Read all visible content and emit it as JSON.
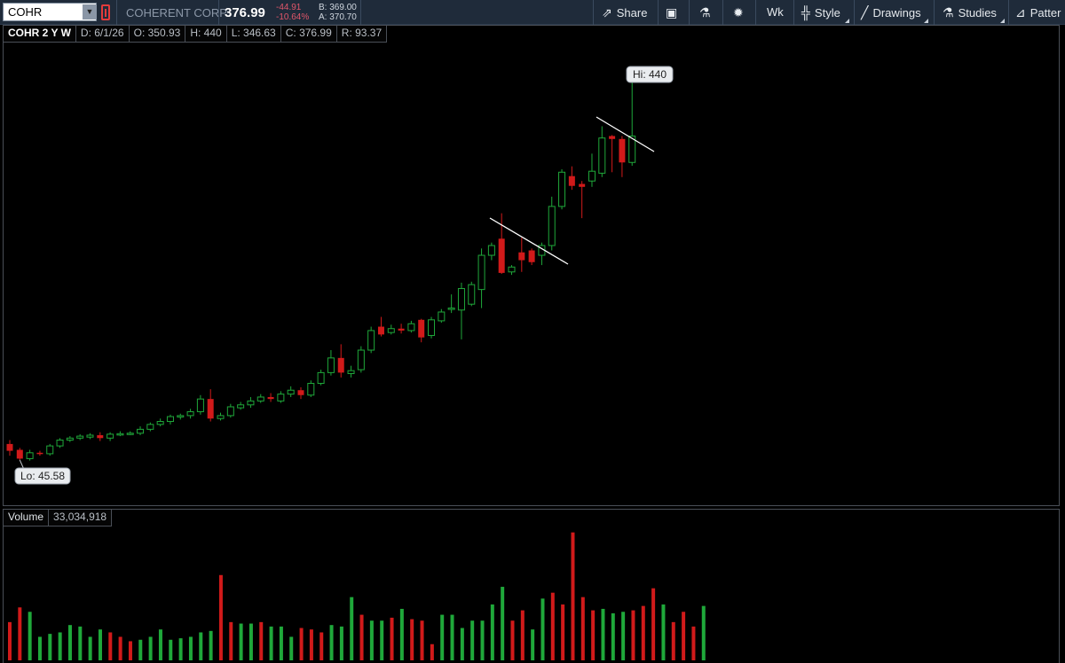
{
  "toolbar": {
    "symbol": "COHR",
    "company": "COHERENT CORP",
    "last": "376.99",
    "change": "-44.91",
    "change_pct": "-10.64%",
    "bid": "B: 369.00",
    "ask": "A: 370.70",
    "share_label": "Share",
    "timeframe_label": "Wk",
    "style_label": "Style",
    "drawings_label": "Drawings",
    "studies_label": "Studies",
    "patterns_label": "Patter"
  },
  "info": {
    "title": "COHR 2 Y W",
    "date": "D: 6/1/26",
    "open": "O: 350.93",
    "high": "H: 440",
    "low": "L: 346.63",
    "close": "C: 376.99",
    "range": "R: 93.37"
  },
  "annotations": {
    "hi_label": "Hi: 440",
    "lo_label": "Lo: 45.58"
  },
  "volume": {
    "label": "Volume",
    "value": "33,034,918"
  },
  "colors": {
    "up": "#1fa83a",
    "down": "#d11a1a",
    "background": "#000000",
    "toolbar": "#1f2b3a"
  },
  "chart_data": {
    "type": "candlestick",
    "ylim": [
      0,
      480
    ],
    "candles": [
      [
        62,
        55,
        66,
        50,
        "d"
      ],
      [
        56,
        47,
        58,
        45.58,
        "d"
      ],
      [
        47,
        53,
        56,
        45,
        "u"
      ],
      [
        53,
        52,
        55,
        50,
        "d"
      ],
      [
        52,
        60,
        62,
        50,
        "u"
      ],
      [
        60,
        66,
        68,
        58,
        "u"
      ],
      [
        66,
        68,
        70,
        64,
        "u"
      ],
      [
        68,
        70,
        72,
        66,
        "u"
      ],
      [
        69,
        71,
        73,
        67,
        "u"
      ],
      [
        71,
        68,
        74,
        65,
        "d"
      ],
      [
        68,
        72,
        74,
        65,
        "u"
      ],
      [
        72,
        72.5,
        75,
        70,
        "u"
      ],
      [
        72,
        73,
        75,
        71,
        "u"
      ],
      [
        73,
        77,
        80,
        71,
        "u"
      ],
      [
        77,
        82,
        84,
        75,
        "u"
      ],
      [
        82,
        85,
        88,
        80,
        "u"
      ],
      [
        85,
        90,
        92,
        82,
        "u"
      ],
      [
        90,
        91,
        93,
        87,
        "u"
      ],
      [
        91,
        95,
        98,
        88,
        "u"
      ],
      [
        95,
        108,
        112,
        92,
        "u"
      ],
      [
        108,
        88,
        118,
        85,
        "d"
      ],
      [
        88,
        91,
        94,
        86,
        "u"
      ],
      [
        91,
        100,
        103,
        89,
        "u"
      ],
      [
        99,
        102,
        105,
        97,
        "u"
      ],
      [
        102,
        106,
        110,
        99,
        "u"
      ],
      [
        106,
        110,
        113,
        104,
        "u"
      ],
      [
        110,
        108,
        114,
        105,
        "d"
      ],
      [
        106,
        113,
        116,
        104,
        "u"
      ],
      [
        113,
        117,
        121,
        110,
        "u"
      ],
      [
        117,
        112,
        120,
        108,
        "d"
      ],
      [
        112,
        124,
        127,
        110,
        "u"
      ],
      [
        124,
        135,
        138,
        122,
        "u"
      ],
      [
        135,
        150,
        158,
        132,
        "u"
      ],
      [
        150,
        135,
        164,
        130,
        "d"
      ],
      [
        134,
        137,
        142,
        130,
        "u"
      ],
      [
        138,
        158,
        162,
        135,
        "u"
      ],
      [
        158,
        178,
        182,
        155,
        "u"
      ],
      [
        182,
        174,
        192,
        172,
        "d"
      ],
      [
        176,
        180,
        184,
        174,
        "u"
      ],
      [
        180,
        178,
        185,
        175,
        "d"
      ],
      [
        178,
        185,
        188,
        176,
        "u"
      ],
      [
        189,
        171,
        190,
        166,
        "d"
      ],
      [
        173,
        189,
        192,
        170,
        "u"
      ],
      [
        188,
        197,
        200,
        186,
        "u"
      ],
      [
        200,
        201,
        215,
        196,
        "u"
      ],
      [
        199,
        221,
        227,
        169,
        "u"
      ],
      [
        205,
        225,
        228,
        203,
        "u"
      ],
      [
        220,
        255,
        262,
        201,
        "u"
      ],
      [
        255,
        265,
        268,
        250,
        "u"
      ],
      [
        272,
        237,
        298,
        236,
        "d"
      ],
      [
        243,
        238,
        245,
        235,
        "u"
      ],
      [
        258,
        250,
        273,
        238,
        "d"
      ],
      [
        260,
        248,
        262,
        245,
        "d"
      ],
      [
        255,
        265,
        268,
        245,
        "u"
      ],
      [
        265,
        305,
        315,
        260,
        "u"
      ],
      [
        305,
        340,
        343,
        302,
        "u"
      ],
      [
        336,
        326,
        346,
        322,
        "d"
      ],
      [
        328,
        325,
        331,
        293,
        "d"
      ],
      [
        331,
        341,
        359,
        325,
        "u"
      ],
      [
        339,
        375,
        387,
        335,
        "u"
      ],
      [
        374,
        377,
        378,
        340,
        "d"
      ],
      [
        374,
        350,
        377,
        335,
        "d"
      ],
      [
        350,
        376.99,
        440,
        346.63,
        "u"
      ]
    ],
    "volume_max": 8.8,
    "volume": [
      [
        2.6,
        "d"
      ],
      [
        3.6,
        "d"
      ],
      [
        3.3,
        "u"
      ],
      [
        1.6,
        "u"
      ],
      [
        1.8,
        "u"
      ],
      [
        1.9,
        "u"
      ],
      [
        2.4,
        "u"
      ],
      [
        2.3,
        "u"
      ],
      [
        1.6,
        "u"
      ],
      [
        2.1,
        "u"
      ],
      [
        1.9,
        "d"
      ],
      [
        1.6,
        "d"
      ],
      [
        1.3,
        "d"
      ],
      [
        1.4,
        "u"
      ],
      [
        1.6,
        "u"
      ],
      [
        2.1,
        "u"
      ],
      [
        1.4,
        "u"
      ],
      [
        1.5,
        "u"
      ],
      [
        1.6,
        "u"
      ],
      [
        1.9,
        "u"
      ],
      [
        2.0,
        "u"
      ],
      [
        5.8,
        "d"
      ],
      [
        2.6,
        "d"
      ],
      [
        2.5,
        "u"
      ],
      [
        2.5,
        "u"
      ],
      [
        2.6,
        "d"
      ],
      [
        2.3,
        "u"
      ],
      [
        2.3,
        "u"
      ],
      [
        1.6,
        "u"
      ],
      [
        2.2,
        "d"
      ],
      [
        2.1,
        "d"
      ],
      [
        1.9,
        "d"
      ],
      [
        2.4,
        "u"
      ],
      [
        2.3,
        "u"
      ],
      [
        4.3,
        "u"
      ],
      [
        3.1,
        "d"
      ],
      [
        2.7,
        "u"
      ],
      [
        2.7,
        "u"
      ],
      [
        2.9,
        "d"
      ],
      [
        3.5,
        "u"
      ],
      [
        2.8,
        "d"
      ],
      [
        2.7,
        "d"
      ],
      [
        1.1,
        "d"
      ],
      [
        3.1,
        "u"
      ],
      [
        3.1,
        "u"
      ],
      [
        2.2,
        "u"
      ],
      [
        2.7,
        "u"
      ],
      [
        2.7,
        "u"
      ],
      [
        3.8,
        "u"
      ],
      [
        5.0,
        "u"
      ],
      [
        2.7,
        "d"
      ],
      [
        3.4,
        "d"
      ],
      [
        2.1,
        "u"
      ],
      [
        4.2,
        "u"
      ],
      [
        4.6,
        "d"
      ],
      [
        3.8,
        "d"
      ],
      [
        8.7,
        "d"
      ],
      [
        4.3,
        "d"
      ],
      [
        3.4,
        "d"
      ],
      [
        3.5,
        "u"
      ],
      [
        3.2,
        "u"
      ],
      [
        3.3,
        "u"
      ],
      [
        3.4,
        "d"
      ],
      [
        3.7,
        "d"
      ],
      [
        4.9,
        "d"
      ],
      [
        3.8,
        "u"
      ],
      [
        2.6,
        "d"
      ],
      [
        3.3,
        "d"
      ],
      [
        2.3,
        "d"
      ],
      [
        3.7,
        "u"
      ]
    ]
  }
}
